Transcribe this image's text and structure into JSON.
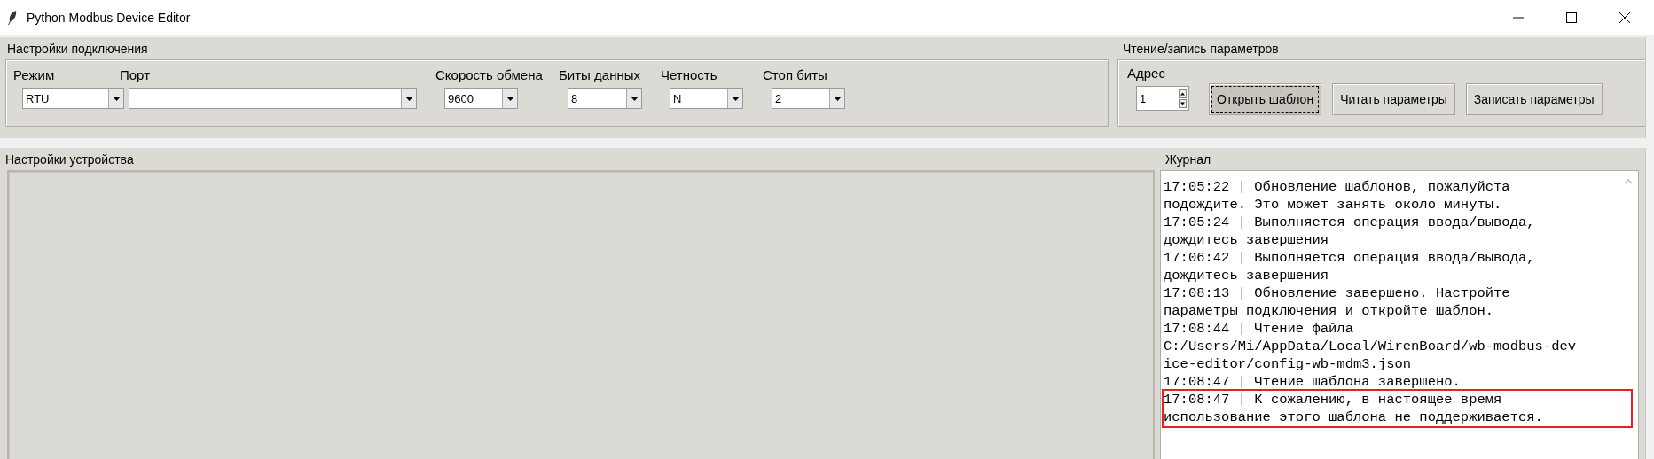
{
  "window": {
    "title": "Python Modbus Device Editor"
  },
  "connection": {
    "title": "Настройки подключения",
    "fields": [
      {
        "label": "Режим",
        "value": "RTU"
      },
      {
        "label": "Порт"
      },
      {
        "label": "Скорость обмена",
        "value": "9600"
      },
      {
        "label": "Биты данных",
        "value": "8"
      },
      {
        "label": "Четность",
        "value": "N"
      },
      {
        "label": "Стоп биты",
        "value": "2"
      }
    ]
  },
  "params": {
    "title": "Чтение/запись параметров",
    "address": {
      "label": "Адрес",
      "value": "1"
    },
    "buttons": [
      {
        "label": "Открыть шаблон",
        "focused": true
      },
      {
        "label": "Читать параметры",
        "focused": false
      },
      {
        "label": "Записать параметры",
        "focused": false
      }
    ]
  },
  "device": {
    "title": "Настройки устройства"
  },
  "journal": {
    "title": "Журнал",
    "entries": [
      {
        "lines": [
          "17:05:22 | Обновление шаблонов, пожалуйста",
          "подождите. Это может занять около минуты."
        ],
        "highlighted": false
      },
      {
        "lines": [
          "17:05:24 | Выполняется операция ввода/вывода,",
          "дождитесь завершения"
        ],
        "highlighted": false
      },
      {
        "lines": [
          "17:06:42 | Выполняется операция ввода/вывода,",
          "дождитесь завершения"
        ],
        "highlighted": false
      },
      {
        "lines": [
          "17:08:13 | Обновление завершено. Настройте",
          "параметры подключения и откройте шаблон."
        ],
        "highlighted": false
      },
      {
        "lines": [
          "17:08:44 | Чтение файла",
          "C:/Users/Mi/AppData/Local/WirenBoard/wb-modbus-dev",
          "ice-editor/config-wb-mdm3.json"
        ],
        "highlighted": false
      },
      {
        "lines": [
          "17:08:47 | Чтение шаблона завершено."
        ],
        "highlighted": false
      },
      {
        "lines": [
          "17:08:47 | К сожалению, в настоящее время",
          "использование этого шаблона не поддерживается."
        ],
        "highlighted": true
      }
    ]
  }
}
